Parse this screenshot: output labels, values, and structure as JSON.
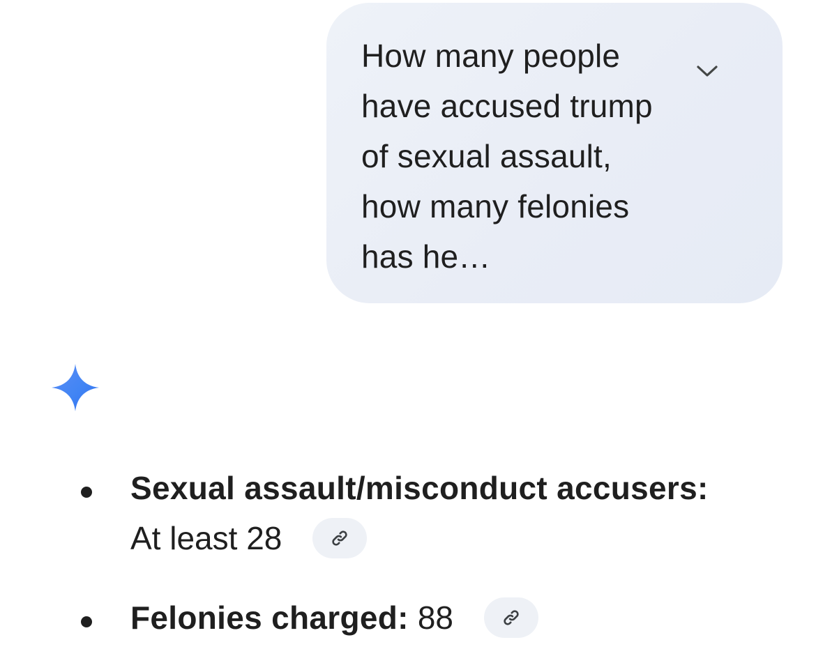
{
  "prompt": {
    "text": "How many people have accused trump of sexual assault, how many felonies has he…",
    "expand_icon": "chevron-down-icon"
  },
  "assistant": {
    "avatar_icon": "gemini-sparkle-icon",
    "avatar_colors": [
      "#4285f4",
      "#5b8df6",
      "#2f6ff0"
    ]
  },
  "response": {
    "items": [
      {
        "label": "Sexual assault/misconduct accusers:",
        "value": "At least 28",
        "source_icon": "link-icon"
      },
      {
        "label": "Felonies charged:",
        "value": "88",
        "source_icon": "link-icon"
      }
    ]
  },
  "colors": {
    "bubble": "#e9edf6",
    "chip": "#eef1f6",
    "text": "#1f1f1f"
  }
}
